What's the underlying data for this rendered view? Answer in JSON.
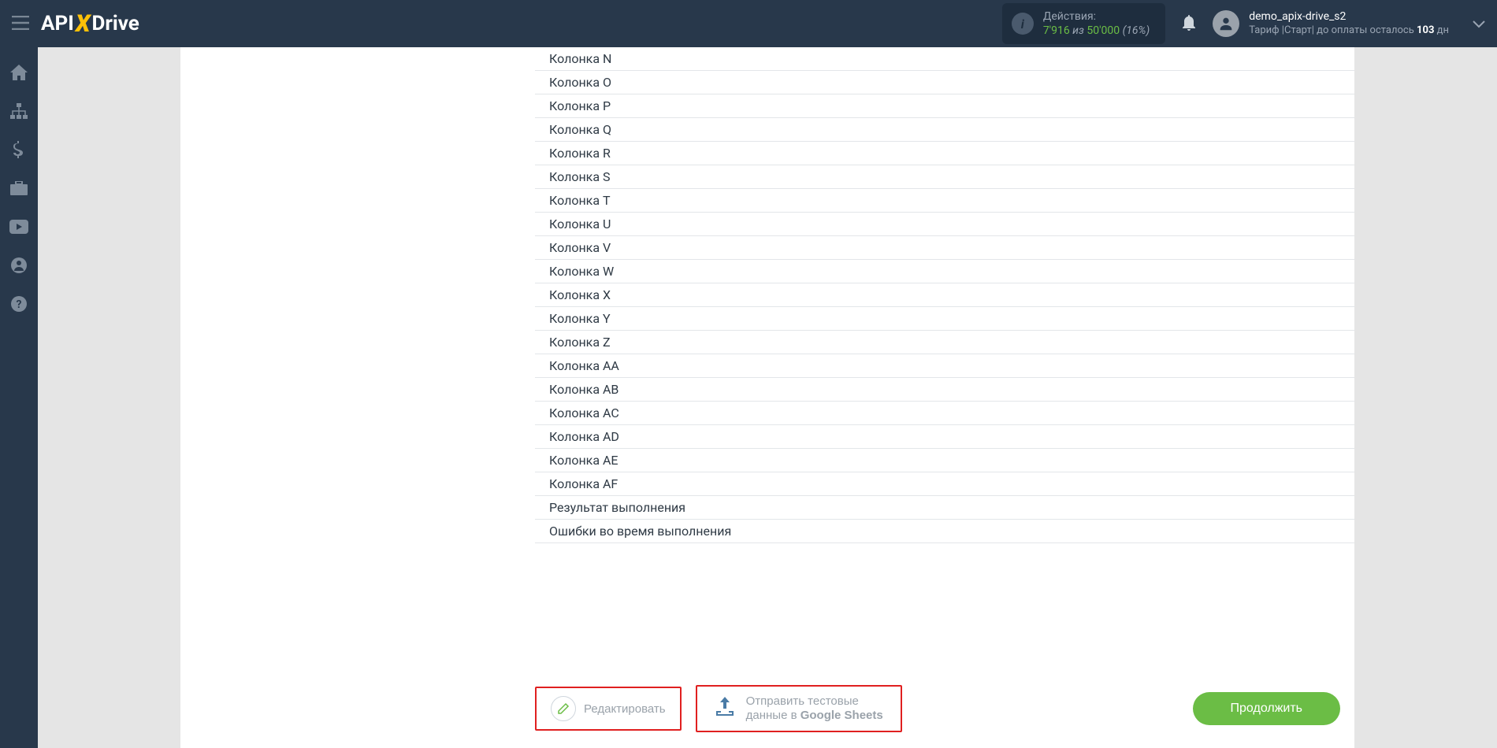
{
  "header": {
    "logo": {
      "api": "API",
      "drive": "Drive"
    },
    "actions": {
      "label": "Действия:",
      "current": "7'916",
      "sep": " из ",
      "limit": "50'000",
      "percent": "(16%)"
    },
    "user": {
      "name": "demo_apix-drive_s2",
      "tariff_prefix": "Тариф |Старт| до оплаты осталось ",
      "days": "103",
      "tariff_suffix": " дн"
    }
  },
  "columns": [
    "Колонка N",
    "Колонка O",
    "Колонка P",
    "Колонка Q",
    "Колонка R",
    "Колонка S",
    "Колонка T",
    "Колонка U",
    "Колонка V",
    "Колонка W",
    "Колонка X",
    "Колонка Y",
    "Колонка Z",
    "Колонка AA",
    "Колонка AB",
    "Колонка AC",
    "Колонка AD",
    "Колонка AE",
    "Колонка AF",
    "Результат выполнения",
    "Ошибки во время выполнения"
  ],
  "buttons": {
    "edit": "Редактировать",
    "send_line1": "Отправить тестовые",
    "send_line2_prefix": "данные в ",
    "send_line2_strong": "Google Sheets",
    "continue": "Продолжить"
  }
}
